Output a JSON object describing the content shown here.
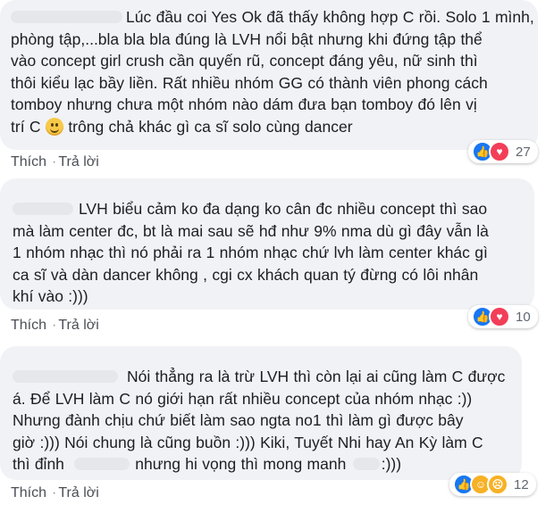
{
  "comments": [
    {
      "lines": [
        "Lúc đầu coi Yes Ok đã thấy không hợp C rồi. Solo 1 mình,",
        "phòng tập,...bla bla bla đúng là LVH nổi bật nhưng khi đứng tập thể",
        "vào concept girl crush cần quyến rũ, concept đáng yêu, nữ sinh thì",
        "thôi kiểu lạc bầy liền. Rất nhiều nhóm GG có thành viên phong cách",
        "tomboy nhưng chưa một nhóm nào dám đưa bạn tomboy đó lên vị",
        "trí C",
        "trông chả khác gì ca sĩ solo cùng dancer"
      ],
      "like_label": "Thích",
      "reply_label": "Trả lời",
      "reactions": [
        "like-icon",
        "love-icon"
      ],
      "reaction_count": "27"
    },
    {
      "lines": [
        "LVH biểu cảm ko đa dạng ko cân đc nhiều concept thì sao",
        "mà làm center đc, bt là mai sau sẽ hđ như 9% nma dù gì đây vẫn là",
        "1 nhóm nhạc thì nó phải ra 1 nhóm nhạc chứ lvh làm center khác gì",
        "ca sĩ và dàn dancer không , cgi cx khách quan tý đừng có lôi nhân",
        "khí vào :)))"
      ],
      "like_label": "Thích",
      "reply_label": "Trả lời",
      "reactions": [
        "like-icon",
        "love-icon"
      ],
      "reaction_count": "10"
    },
    {
      "lines": [
        "Nói thẳng ra là trừ LVH thì còn lại ai cũng làm C được",
        "á. Để LVH làm C nó giới hạn rất nhiều concept của nhóm nhạc :))",
        "Nhưng đành chịu chứ biết làm sao ngta no1 thì làm gì được bây",
        "giờ :))) Nói chung là cũng buồn :))) Kiki, Tuyết Nhi hay An Kỳ làm C",
        "thì đỉnh",
        "nhưng hi vọng thì mong manh",
        ":)))"
      ],
      "like_label": "Thích",
      "reply_label": "Trả lời",
      "reactions": [
        "like-icon",
        "haha-icon",
        "sad-icon"
      ],
      "reaction_count": "12"
    }
  ],
  "colors": {
    "bubble": "#f1f2f6",
    "like": "#1877f2",
    "love": "#f33e58",
    "haha": "#f7b125"
  }
}
